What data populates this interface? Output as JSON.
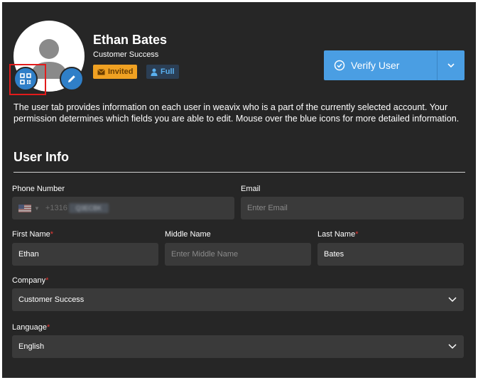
{
  "user": {
    "name": "Ethan Bates",
    "role": "Customer Success",
    "status_badge": "Invited",
    "access_badge": "Full"
  },
  "actions": {
    "verify_label": "Verify User"
  },
  "description": "The user tab provides information on each user in weavix who is a part of the currently selected account. Your permission determines which fields you are able to edit. Mouse over the blue icons for more detailed information.",
  "section": {
    "title": "User Info"
  },
  "form": {
    "phone": {
      "label": "Phone Number",
      "dial_code": "+1316",
      "value_masked": "Q3ECBK"
    },
    "email": {
      "label": "Email",
      "placeholder": "Enter Email",
      "value": ""
    },
    "first_name": {
      "label": "First Name",
      "value": "Ethan",
      "required": "*"
    },
    "middle_name": {
      "label": "Middle Name",
      "placeholder": "Enter Middle Name",
      "value": ""
    },
    "last_name": {
      "label": "Last Name",
      "value": "Bates",
      "required": "*"
    },
    "company": {
      "label": "Company",
      "value": "Customer Success",
      "required": "*"
    },
    "language": {
      "label": "Language",
      "value": "English",
      "required": "*"
    }
  },
  "colors": {
    "panel_bg": "#262626",
    "field_bg": "#3a3a3a",
    "accent_blue": "#4a9ee3",
    "invited_orange": "#f0a122",
    "highlight_red": "#e21b1b"
  },
  "icons": [
    "user-avatar-icon",
    "qr-code-icon",
    "pencil-icon",
    "envelope-icon",
    "person-icon",
    "check-circle-icon",
    "chevron-down-icon",
    "us-flag-icon"
  ]
}
